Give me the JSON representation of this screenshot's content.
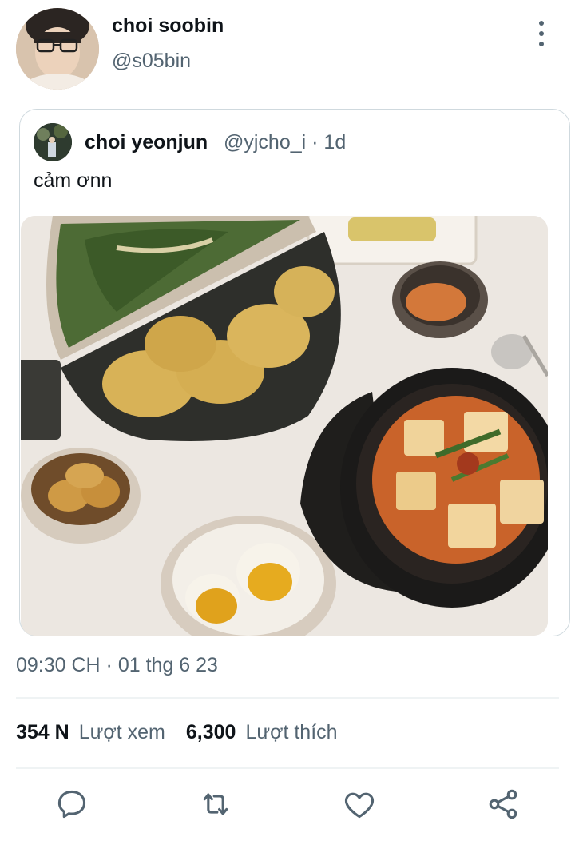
{
  "tweet": {
    "author_name": "choi soobin",
    "author_handle": "@s05bin",
    "timestamp": "09:30 CH · 01 thg 6 23",
    "views_count": "354 N",
    "views_label": "Lượt xem",
    "likes_count": "6,300",
    "likes_label": "Lượt thích"
  },
  "quoted": {
    "author_name": "choi yeonjun",
    "handle_time": "@yjcho_i · 1d",
    "text": "cảm ơnn"
  },
  "colors": {
    "text": "#0f1419",
    "secondary": "#536471",
    "accent": "#1d9bf0",
    "border": "#cfd9de"
  },
  "icons": [
    "more-vertical-icon",
    "reply-icon",
    "retweet-icon",
    "like-icon",
    "share-icon"
  ]
}
